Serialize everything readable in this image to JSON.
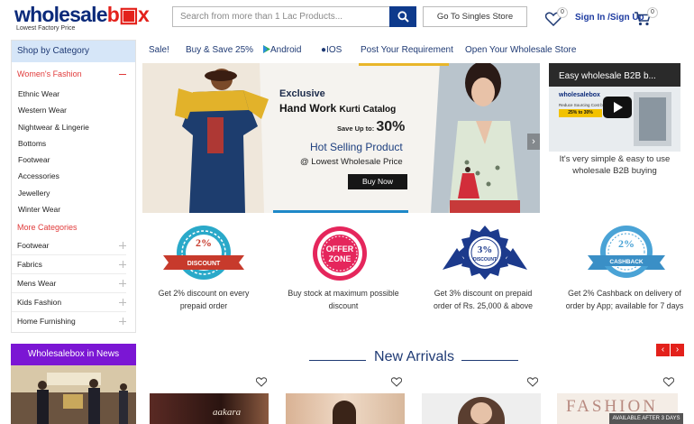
{
  "header": {
    "logo_text_1": "wholesale",
    "logo_text_2": "b",
    "logo_text_3": "x",
    "logo_tagline": "Lowest Factory Price",
    "search_placeholder": "Search from more than 1 Lac Products...",
    "singles_label": "Go To Singles Store",
    "wishlist_count": "0",
    "signin_label": "Sign In /Sign Up",
    "cart_count": "0"
  },
  "sidebar": {
    "heading": "Shop by Category",
    "active_category": "Women's Fashion",
    "subcategories": [
      "Ethnic Wear",
      "Western Wear",
      "Nightwear & Lingerie",
      "Bottoms",
      "Footwear",
      "Accessories",
      "Jewellery",
      "Winter Wear"
    ],
    "more_label": "More Categories",
    "more_items": [
      "Footwear",
      "Fabrics",
      "Mens Wear",
      "Kids Fashion",
      "Home Furnishing"
    ]
  },
  "news": {
    "heading": "Wholesalebox in News"
  },
  "topnav": {
    "items": [
      "Sale!",
      "Buy & Save 25%",
      "Android",
      "IOS",
      "Post Your Requirement",
      "Open Your Wholesale Store"
    ]
  },
  "banner": {
    "line1": "Exclusive",
    "line2": "Hand Work",
    "line2b": "Kurti Catalog",
    "save_label": "Save Up to:",
    "save_pct": "30%",
    "hot": "Hot Selling Product",
    "lowest": "@ Lowest Wholesale Price",
    "button": "Buy Now",
    "prev": "‹",
    "next": "›"
  },
  "video": {
    "title": "Easy wholesale B2B b...",
    "caption": "It's very simple & easy to use wholesale B2B buying",
    "inner_logo": "wholesalebox",
    "inner_text": "Reduce Sourcing Cost by",
    "inner_pct": "25% to 30%"
  },
  "offers": [
    {
      "badge_top": "2%",
      "badge_bottom": "DISCOUNT",
      "text": "Get 2% discount on every prepaid order",
      "color": "#2aa9c9"
    },
    {
      "badge_top": "OFFER",
      "badge_bottom": "ZONE",
      "text": "Buy stock at maximum possible discount",
      "color": "#e5265c"
    },
    {
      "badge_top": "3%",
      "badge_bottom": "DISCOUNT",
      "text": "Get 3% discount on prepaid order of Rs. 25,000 & above",
      "color": "#1c3a8c"
    },
    {
      "badge_top": "2%",
      "badge_bottom": "CASHBACK",
      "text": "Get 2% Cashback on delivery of order by App; available for 7 days",
      "color": "#4aa3d6"
    }
  ],
  "new_arrivals": {
    "title": "New Arrivals",
    "prev": "‹",
    "next": "›",
    "product_labels": [
      "aakara",
      "",
      "",
      "FASHION"
    ],
    "availability": "AVAILABLE AFTER 3 DAYS"
  },
  "colors": {
    "brand_blue": "#0e3a8c",
    "brand_red": "#e3211b",
    "sidebar_heading_bg": "#d6e6f8",
    "news_heading_bg": "#7b16d4",
    "accent_red": "#e03a3a"
  }
}
